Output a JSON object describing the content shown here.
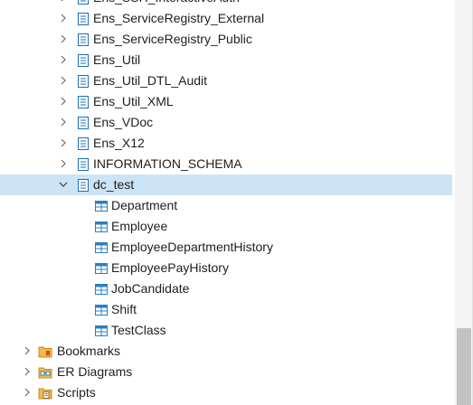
{
  "tree": {
    "schemas": [
      {
        "label": "Ens_SSH_InteractiveAuth",
        "expanded": false
      },
      {
        "label": "Ens_ServiceRegistry_External",
        "expanded": false
      },
      {
        "label": "Ens_ServiceRegistry_Public",
        "expanded": false
      },
      {
        "label": "Ens_Util",
        "expanded": false
      },
      {
        "label": "Ens_Util_DTL_Audit",
        "expanded": false
      },
      {
        "label": "Ens_Util_XML",
        "expanded": false
      },
      {
        "label": "Ens_VDoc",
        "expanded": false
      },
      {
        "label": "Ens_X12",
        "expanded": false
      },
      {
        "label": "INFORMATION_SCHEMA",
        "expanded": false
      },
      {
        "label": "dc_test",
        "expanded": true,
        "selected": true
      }
    ],
    "tables": [
      {
        "label": "Department"
      },
      {
        "label": "Employee"
      },
      {
        "label": "EmployeeDepartmentHistory"
      },
      {
        "label": "EmployeePayHistory"
      },
      {
        "label": "JobCandidate"
      },
      {
        "label": "Shift"
      },
      {
        "label": "TestClass"
      }
    ],
    "folders": [
      {
        "label": "Bookmarks",
        "icon": "bookmarks-folder-icon"
      },
      {
        "label": "ER Diagrams",
        "icon": "er-diagrams-folder-icon"
      },
      {
        "label": "Scripts",
        "icon": "scripts-folder-icon"
      }
    ]
  },
  "colors": {
    "selection": "#cce4f7",
    "schema_icon": "#1c6fb5",
    "table_icon": "#2a7fc4",
    "folder_icon": "#e8a33d"
  }
}
